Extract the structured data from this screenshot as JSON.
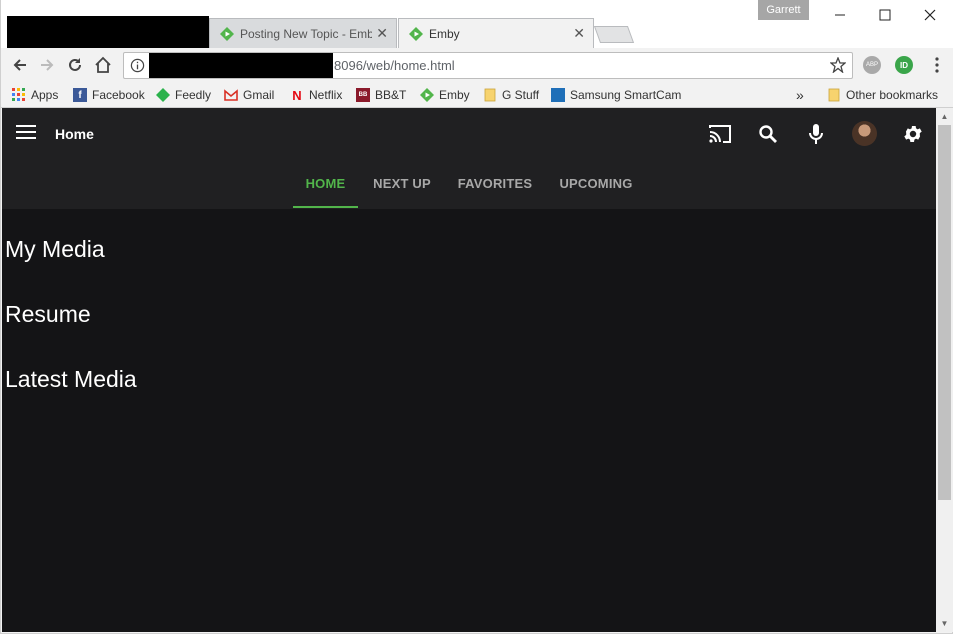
{
  "browser": {
    "tabs": [
      {
        "title": "Posting New Topic - Emb",
        "active": false
      },
      {
        "title": "Emby",
        "active": true
      }
    ],
    "profile_name": "Garrett",
    "url": "8096/web/home.html",
    "bookmarks": [
      {
        "label": "Apps",
        "icon": "apps-grid-icon"
      },
      {
        "label": "Facebook",
        "icon": "facebook-icon"
      },
      {
        "label": "Feedly",
        "icon": "feedly-icon"
      },
      {
        "label": "Gmail",
        "icon": "gmail-icon"
      },
      {
        "label": "Netflix",
        "icon": "netflix-icon"
      },
      {
        "label": "BB&T",
        "icon": "bbt-icon"
      },
      {
        "label": "Emby",
        "icon": "emby-icon"
      },
      {
        "label": "G Stuff",
        "icon": "folder-icon"
      },
      {
        "label": "Samsung SmartCam",
        "icon": "smartcam-icon"
      }
    ],
    "bookmarks_overflow": "»",
    "other_bookmarks": "Other bookmarks",
    "extensions": [
      "ABP",
      "ID"
    ]
  },
  "app": {
    "title": "Home",
    "nav_tabs": [
      {
        "label": "HOME",
        "active": true
      },
      {
        "label": "NEXT UP",
        "active": false
      },
      {
        "label": "FAVORITES",
        "active": false
      },
      {
        "label": "UPCOMING",
        "active": false
      }
    ],
    "sections": [
      "My Media",
      "Resume",
      "Latest Media"
    ],
    "colors": {
      "accent": "#52b54b",
      "background": "#141416",
      "header": "#202022"
    }
  },
  "scrollbar": {
    "position": 0.0,
    "visible_fraction": 0.72
  }
}
